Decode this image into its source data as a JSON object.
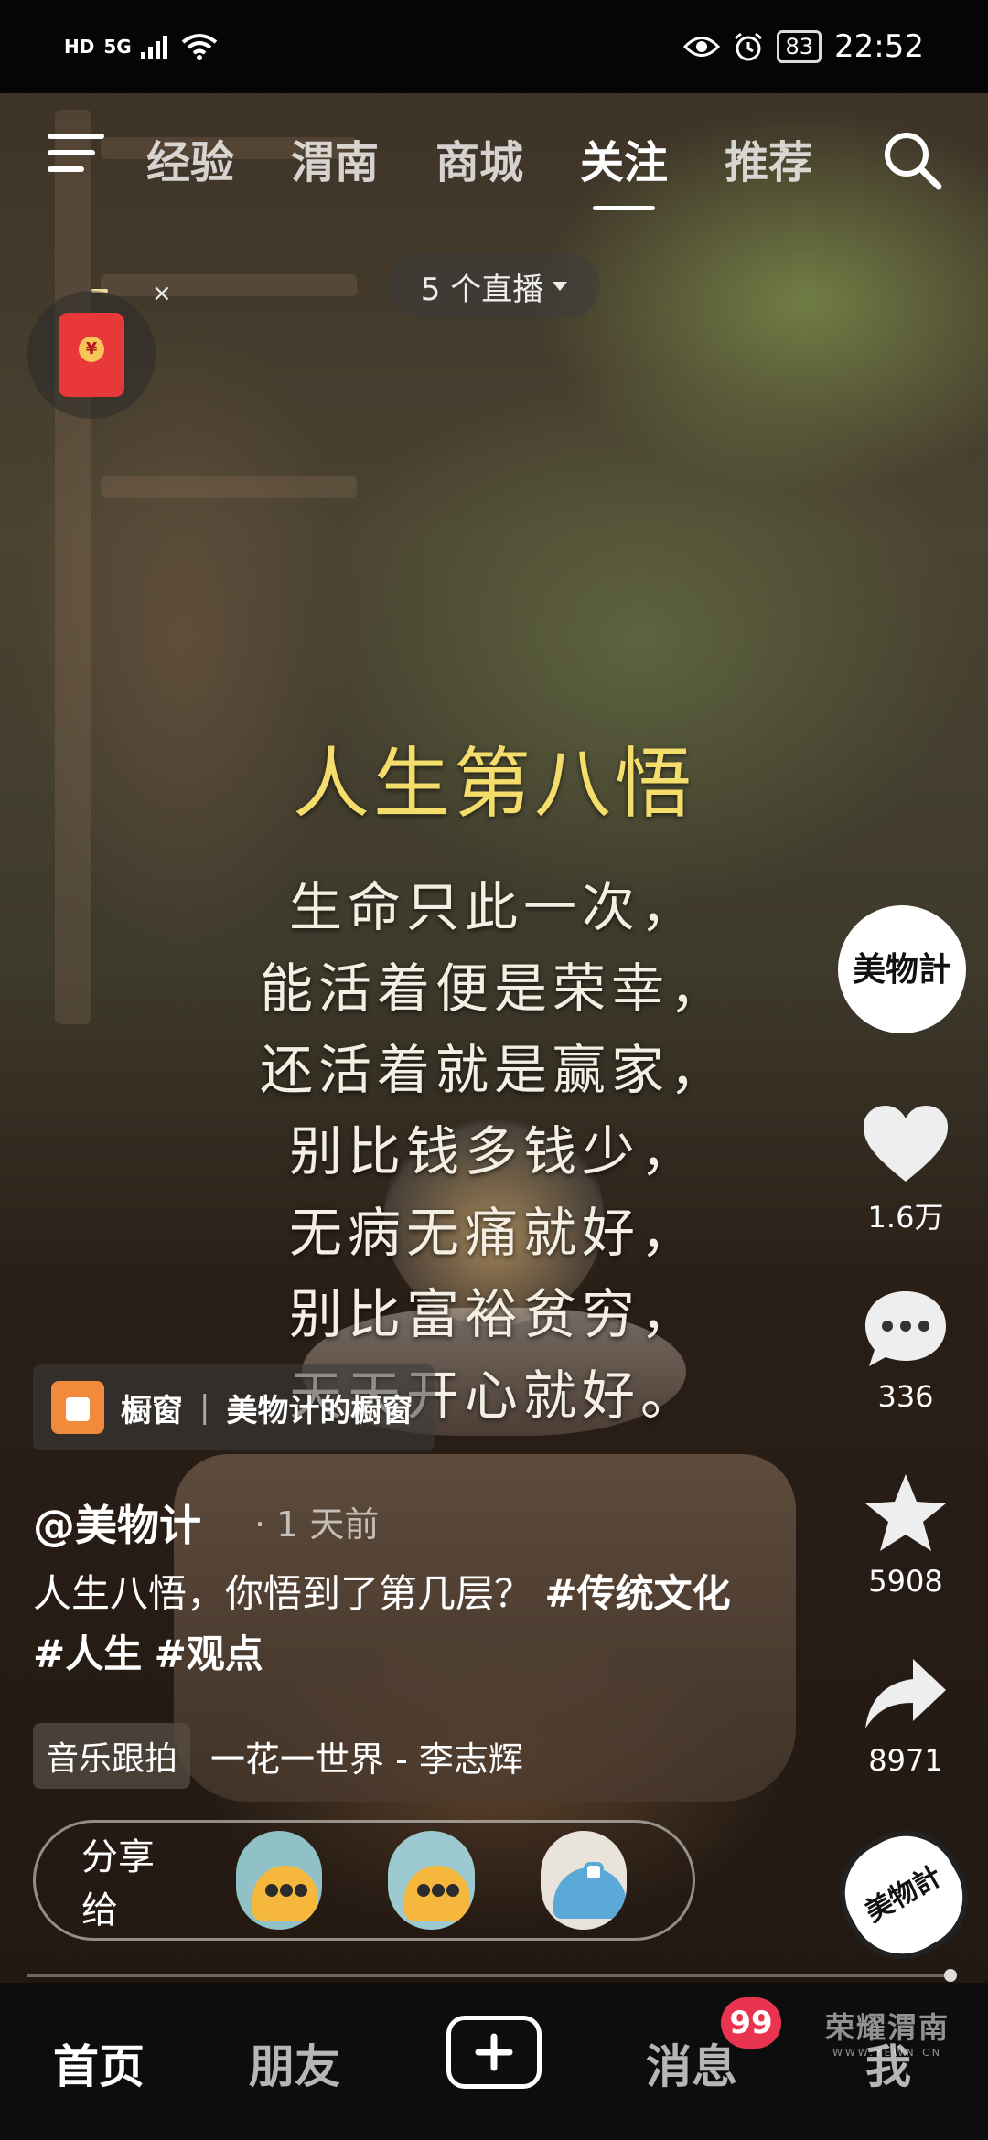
{
  "status_bar": {
    "left_indicators": [
      "HD",
      "5G"
    ],
    "battery": "83",
    "time": "22:52"
  },
  "top_nav": {
    "tabs": [
      "经验",
      "渭南",
      "商城",
      "关注",
      "推荐"
    ],
    "active_tab": "关注"
  },
  "live_pill": "5 个直播",
  "red_packet": {
    "close": "×",
    "seal": "¥"
  },
  "video": {
    "poem_title": "人生第八悟",
    "poem_lines": [
      "生命只此一次，",
      "能活着便是荣幸，",
      "还活着就是赢家，",
      "别比钱多钱少，",
      "无病无痛就好，",
      "别比富裕贫穷，",
      "天天开心就好。"
    ]
  },
  "right_rail": {
    "avatar_text": "美物計",
    "likes": "1.6万",
    "comments": "336",
    "favorites": "5908",
    "shares": "8971",
    "music_disc_text": "美物計"
  },
  "shop_chip": {
    "label": "橱窗",
    "separator": "|",
    "shop_name": "美物计的橱窗"
  },
  "post": {
    "author": "@美物计",
    "time": "· 1 天前",
    "caption_text": "人生八悟，你悟到了第几层？",
    "tags": [
      "#传统文化",
      "#人生",
      "#观点"
    ]
  },
  "music": {
    "badge": "音乐跟拍",
    "track": "一花一世界 - 李志辉"
  },
  "share_bar": {
    "label": "分享给"
  },
  "bottom_nav": {
    "home": "首页",
    "friends": "朋友",
    "messages": "消息",
    "messages_badge": "99",
    "me": "我"
  },
  "watermark": {
    "main": "荣耀渭南",
    "sub": "WWW.YEWN.CN"
  },
  "colors": {
    "poem_title": "#f4dd6a",
    "badge": "#e8344e",
    "shop_icon": "#f28a3c",
    "red_packet": "#e8383a"
  }
}
